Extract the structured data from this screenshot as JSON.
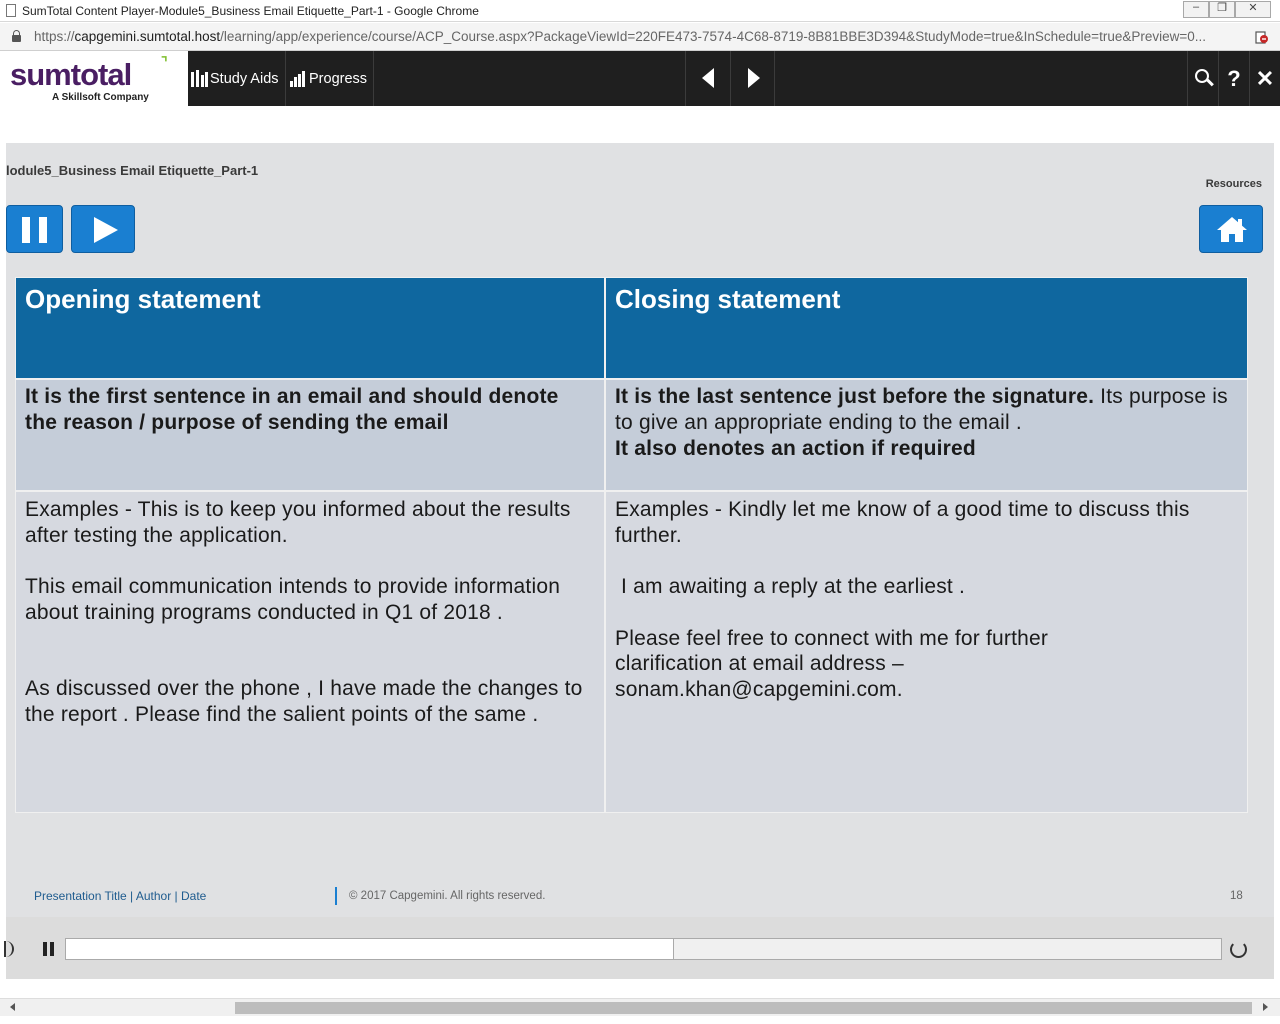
{
  "browser": {
    "window_title": "SumTotal Content Player-Module5_Business Email Etiquette_Part-1 - Google Chrome",
    "url_scheme": "https://",
    "url_host": "capgemini.sumtotal.host",
    "url_path": "/learning/app/experience/course/ACP_Course.aspx?PackageViewId=220FE473-7574-4C68-8719-8B81BBE3D394&StudyMode=true&InSchedule=true&Preview=0..."
  },
  "appbar": {
    "logo_text": "sumtotal",
    "logo_subtitle": "A Skillsoft Company",
    "study_aids_label": "Study Aids",
    "progress_label": "Progress",
    "help_glyph": "?",
    "close_glyph": "✕"
  },
  "slide": {
    "breadcrumb": "lodule5_Business Email Etiquette_Part-1",
    "resources_label": "Resources",
    "table": {
      "headers": [
        "Opening statement",
        "Closing statement"
      ],
      "opening_desc": "It is the first sentence in an email and should denote the reason / purpose of sending the email",
      "closing_desc_bold1": "It is the last sentence just before the signature.",
      "closing_desc_plain": " Its purpose is to give an appropriate ending to the email .",
      "closing_desc_bold2": "It also denotes an action if required",
      "opening_examples": [
        "Examples - This is to keep you informed about the results after testing the application.",
        "This email communication intends to provide information about training programs conducted in Q1 of 2018 .",
        "As discussed over the phone , I have made the changes to the report . Please find the salient points of the same ."
      ],
      "closing_examples": [
        "Examples - Kindly let me know of a good time to discuss this further.",
        " I am awaiting a reply at the earliest .",
        "Please feel free to connect with me for further clarification  at email address – sonam.khan@capgemini.com."
      ]
    },
    "footer": {
      "left": "Presentation Title | Author | Date",
      "copyright": "© 2017 Capgemini. All rights reserved.",
      "page_number": "18"
    }
  },
  "media": {
    "progress_fraction": 0.526
  },
  "colors": {
    "header_blue": "#0f679f",
    "button_blue": "#1a7fd1",
    "logo_purple": "#4a1e63",
    "logo_green": "#7fbf2f"
  }
}
